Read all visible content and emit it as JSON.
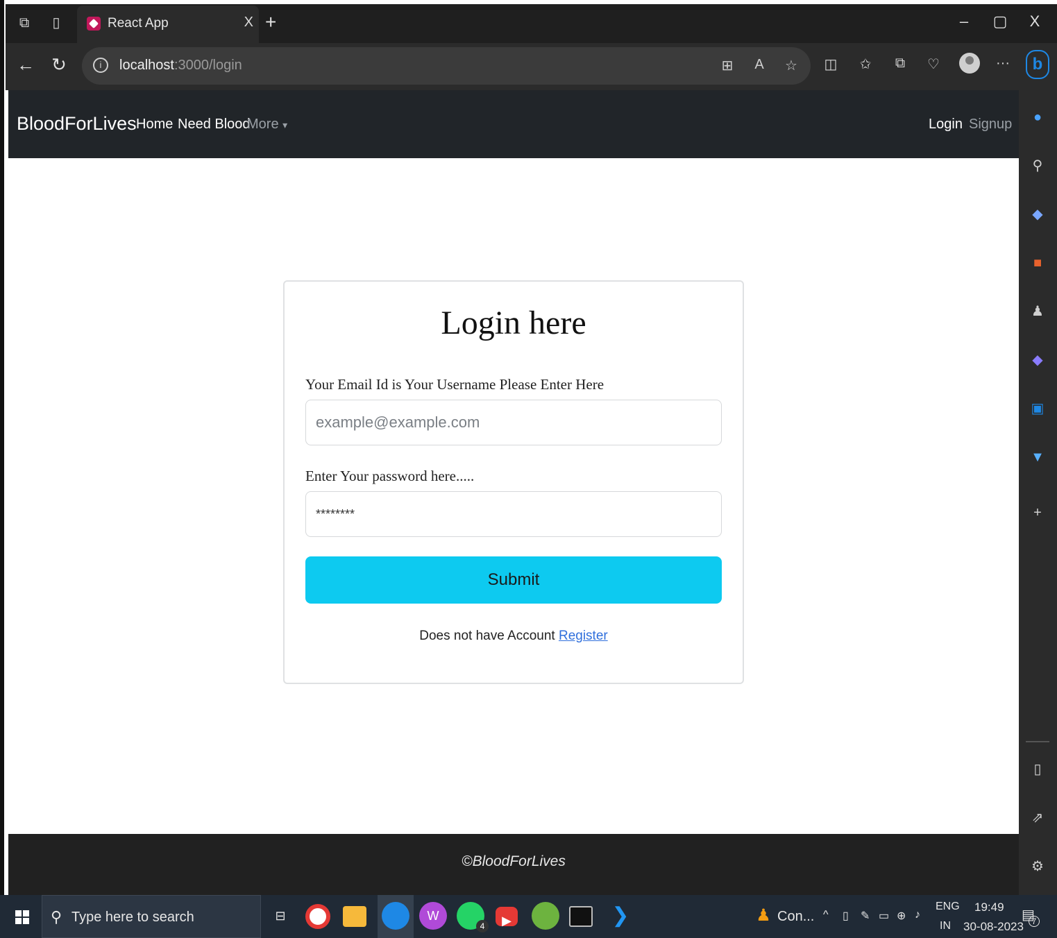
{
  "browser": {
    "tab_title": "React App",
    "tab_close": "X",
    "new_tab": "+",
    "url_host": "localhost",
    "url_path": ":3000/login",
    "window_minimize": "–",
    "window_restore": "▢",
    "window_close": "X",
    "more_menu": "···"
  },
  "navbar": {
    "brand": "BloodForLives",
    "links": [
      "Home",
      "Need Blood",
      "More"
    ],
    "more_caret": "▾",
    "right_links": [
      "Login",
      "Signup"
    ]
  },
  "login": {
    "title": "Login here",
    "email_label": "Your Email Id is Your Username Please Enter Here",
    "email_placeholder": "example@example.com",
    "password_label": "Enter Your password here.....",
    "password_value": "********",
    "submit_label": "Submit",
    "register_prompt": "Does not have Account",
    "register_link": "Register"
  },
  "footer": {
    "text": "©BloodForLives"
  },
  "taskbar": {
    "search_placeholder": "Type here to search",
    "running_app_label": "Con...",
    "whatsapp_badge": "4",
    "lang_line1": "ENG",
    "lang_line2": "IN",
    "time": "19:49",
    "date": "30-08-2023",
    "notification_count": "7"
  },
  "colors": {
    "navbar_bg": "#212529",
    "submit_bg": "#0dcaf0",
    "link": "#2f6fdc",
    "footer_bg": "#212121"
  },
  "icons": [
    "workspaces-icon",
    "tab-actions-icon",
    "back-icon",
    "refresh-icon",
    "info-icon",
    "reader-mode-icon",
    "read-aloud-icon",
    "favorite-star-icon",
    "split-screen-icon",
    "favorites-icon",
    "collections-icon",
    "browser-essentials-icon",
    "profile-icon",
    "bing-copilot-icon",
    "bell-icon",
    "search-icon",
    "tag-icon",
    "toolbox-icon",
    "games-icon",
    "copilot-icon",
    "outlook-icon",
    "drop-icon",
    "add-icon",
    "sidebar-toggle-icon",
    "external-icon",
    "settings-icon",
    "windows-start-icon",
    "chrome-icon",
    "file-explorer-icon",
    "edge-icon",
    "whatsapp-icon",
    "youtube-icon",
    "spring-icon",
    "terminal-icon",
    "vscode-icon"
  ]
}
